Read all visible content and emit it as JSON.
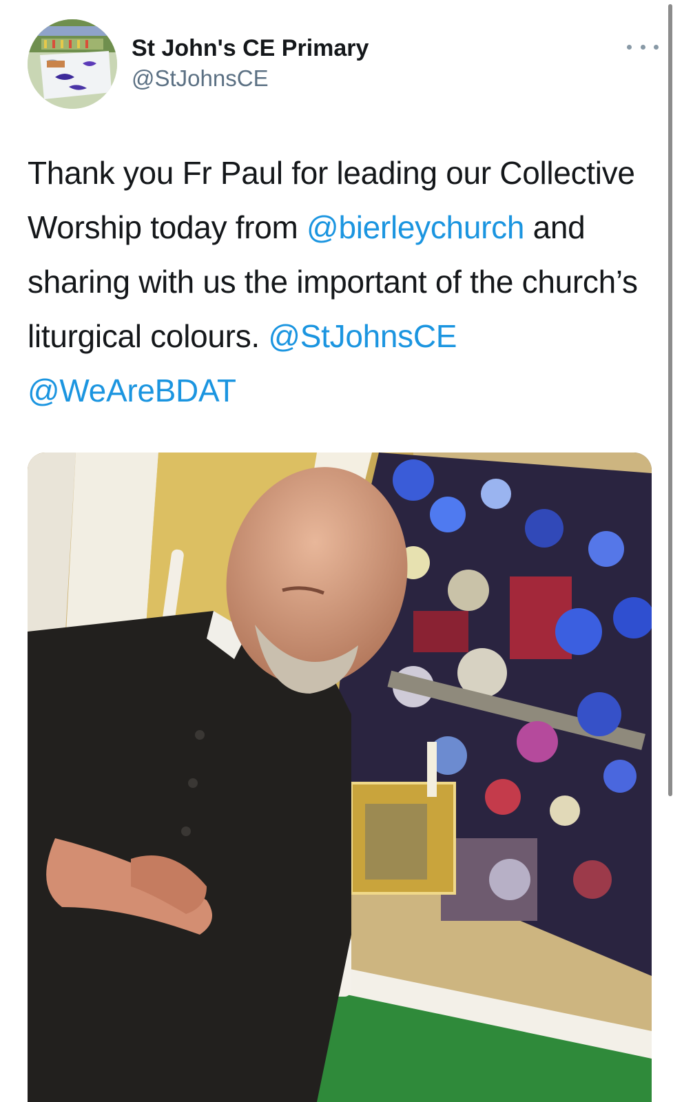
{
  "tweet": {
    "author": {
      "display_name": "St John's CE Primary",
      "handle": "@StJohnsCE",
      "avatar_icon": "school-badge-avatar"
    },
    "more_icon": "more-options-icon",
    "text_segments": [
      {
        "type": "text",
        "value": "Thank you Fr Paul for leading our Collective Worship today from "
      },
      {
        "type": "mention",
        "value": "@bierleychurch"
      },
      {
        "type": "text",
        "value": " and sharing with us the important of the church’s liturgical colours. "
      },
      {
        "type": "mention",
        "value": "@StJohnsCE"
      },
      {
        "type": "text",
        "value": " "
      },
      {
        "type": "mention",
        "value": "@WeAreBDAT"
      }
    ],
    "media": {
      "kind": "photo"
    }
  },
  "colors": {
    "mention": "#1b95e0",
    "handle": "#5b7083",
    "text": "#14171a"
  }
}
